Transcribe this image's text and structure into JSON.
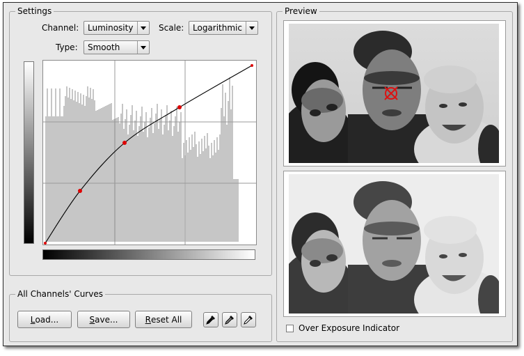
{
  "settings": {
    "title": "Settings",
    "channel_label": "Channel:",
    "channel_value": "Luminosity",
    "scale_label": "Scale:",
    "scale_value": "Logarithmic",
    "type_label": "Type:",
    "type_value": "Smooth"
  },
  "curve": {
    "control_points": [
      [
        0,
        0
      ],
      [
        50,
        75
      ],
      [
        114,
        144
      ],
      [
        193,
        195
      ],
      [
        297,
        255
      ]
    ]
  },
  "all_curves": {
    "title": "All Channels' Curves",
    "load_prefix": "L",
    "load_rest": "oad...",
    "save_prefix": "S",
    "save_rest": "ave...",
    "reset_prefix": "R",
    "reset_rest": "eset All"
  },
  "preview": {
    "title": "Preview",
    "over_exposure_label": "Over Exposure Indicator",
    "over_exposure_checked": false
  },
  "colors": {
    "window_bg": "#e8e8e8",
    "curve_point": "#dd0000",
    "histogram": "#b8b8b8"
  },
  "icons": [
    "color-picker-black-icon",
    "color-picker-gray-icon",
    "color-picker-white-icon",
    "photo-preview-original",
    "photo-preview-result"
  ]
}
